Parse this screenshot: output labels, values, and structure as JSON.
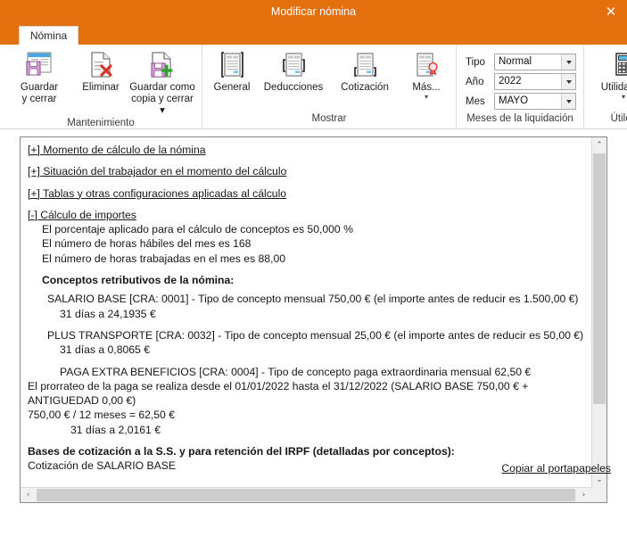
{
  "window": {
    "title": "Modificar nómina",
    "close_label": "✕",
    "accent_color": "#e3700c"
  },
  "tabs": [
    {
      "label": "Nómina",
      "active": true
    }
  ],
  "ribbon": {
    "groups": [
      {
        "name": "mantenimiento",
        "title": "Mantenimiento",
        "buttons": [
          {
            "name": "guardar-y-cerrar",
            "label": "Guardar\ny cerrar",
            "icon": "save-window-icon",
            "caret": false
          },
          {
            "name": "eliminar",
            "label": "Eliminar",
            "icon": "delete-document-icon",
            "caret": false
          },
          {
            "name": "guardar-como-copia-y-cerrar",
            "label": "Guardar como\ncopia y cerrar ▾",
            "icon": "save-copy-icon",
            "caret": false
          }
        ]
      },
      {
        "name": "mostrar",
        "title": "Mostrar",
        "buttons": [
          {
            "name": "general",
            "label": "General",
            "icon": "document-general-icon",
            "caret": false
          },
          {
            "name": "deducciones",
            "label": "Deducciones",
            "icon": "document-deductions-icon",
            "caret": false
          },
          {
            "name": "cotizacion",
            "label": "Cotización",
            "icon": "document-contribution-icon",
            "caret": false
          },
          {
            "name": "mas",
            "label": "Más...",
            "icon": "document-award-icon",
            "caret": true
          }
        ]
      },
      {
        "name": "meses-de-la-liquidacion",
        "title": "Meses de la liquidación",
        "fields": [
          {
            "name": "tipo",
            "label": "Tipo",
            "value": "Normal"
          },
          {
            "name": "ano",
            "label": "Año",
            "value": "2022"
          },
          {
            "name": "mes",
            "label": "Mes",
            "value": "MAYO"
          }
        ]
      },
      {
        "name": "utiles",
        "title": "Útiles",
        "buttons": [
          {
            "name": "utilidades",
            "label": "Utilidades",
            "icon": "calculator-icon",
            "caret": true
          }
        ]
      }
    ]
  },
  "content": {
    "sections": [
      {
        "type": "link",
        "text": "[+] Momento de cálculo de la nómina"
      },
      {
        "type": "link",
        "text": "[+] Situación del trabajador en el momento del cálculo"
      },
      {
        "type": "link",
        "text": "[+] Tablas y otras configuraciones aplicadas al cálculo"
      },
      {
        "type": "link",
        "text": "[-] Cálculo de importes"
      }
    ],
    "lines": {
      "porcentaje": "El porcentaje aplicado para el cálculo de conceptos es 50,000 %",
      "horas_habiles": "El número de horas hábiles del mes es 168",
      "horas_trabajadas": "El número de horas trabajadas en el mes es 88,00",
      "conceptos_heading": "Conceptos retributivos de la nómina:",
      "salario_base": "SALARIO BASE [CRA: 0001] - Tipo de concepto mensual 750,00 € (el importe antes de reducir es 1.500,00 €)",
      "salario_base_dias": "31 días a 24,1935 €",
      "plus_transporte": "PLUS TRANSPORTE [CRA: 0032] - Tipo de concepto mensual 25,00 € (el importe antes de reducir es 50,00 €)",
      "plus_transporte_dias": "31 días a 0,8065 €",
      "paga_extra": "PAGA EXTRA BENEFICIOS [CRA: 0004] - Tipo de concepto paga extraordinaria mensual 62,50 €",
      "prorrateo": "El prorrateo de la paga se realiza desde el 01/01/2022 hasta el 31/12/2022 (SALARIO BASE 750,00 € + ANTIGUEDAD 0,00 €)",
      "division": "750,00 € / 12 meses = 62,50 €",
      "paga_extra_dias": "31 días a 2,0161 €",
      "bases_heading": "Bases de cotización a la S.S. y para retención del IRPF (detalladas por conceptos):",
      "cotizacion_salario": "Cotización de SALARIO BASE"
    }
  },
  "scrollbars": {
    "vertical": {
      "up": "⌃",
      "down": "⌄"
    },
    "horizontal": {
      "left": "‹",
      "right": "›"
    }
  },
  "footer": {
    "copy_link": "Copiar al portapapeles"
  }
}
